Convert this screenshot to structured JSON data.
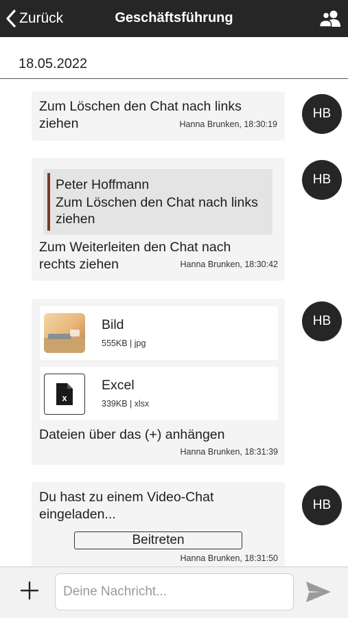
{
  "header": {
    "back_label": "Zurück",
    "title": "Geschäftsführung",
    "back_icon": "chevron-left-icon",
    "members_icon": "group-icon"
  },
  "date_separator": "18.05.2022",
  "messages": [
    {
      "text": "Zum Löschen den Chat nach links ziehen",
      "meta": "Hanna Brunken, 18:30:19",
      "avatar": "HB"
    },
    {
      "quote": {
        "author": "Peter Hoffmann",
        "text": "Zum Löschen den Chat nach links ziehen"
      },
      "text": "Zum Weiterleiten den Chat nach rechts ziehen",
      "meta": "Hanna Brunken, 18:30:42",
      "avatar": "HB"
    },
    {
      "attachments": [
        {
          "name": "Bild",
          "info": "555KB | jpg",
          "icon": "image-thumbnail"
        },
        {
          "name": "Excel",
          "info": "339KB | xlsx",
          "icon": "excel-file-icon"
        }
      ],
      "text": "Dateien über das (+) anhängen",
      "meta": "Hanna Brunken, 18:31:39",
      "avatar": "HB"
    },
    {
      "text": "Du hast zu einem Video-Chat eingeladen...",
      "button_label": "Beitreten",
      "meta": "Hanna Brunken, 18:31:50",
      "avatar": "HB"
    }
  ],
  "composer": {
    "placeholder": "Deine Nachricht...",
    "value": "",
    "add_icon": "plus-icon",
    "send_icon": "send-icon"
  },
  "colors": {
    "header_bg": "#262626",
    "bubble_bg": "#f4f4f4",
    "quote_bg": "#e4e4e4",
    "quote_accent": "#7a3a2a",
    "avatar_bg": "#262626",
    "composer_bg": "#f2f2f2"
  }
}
